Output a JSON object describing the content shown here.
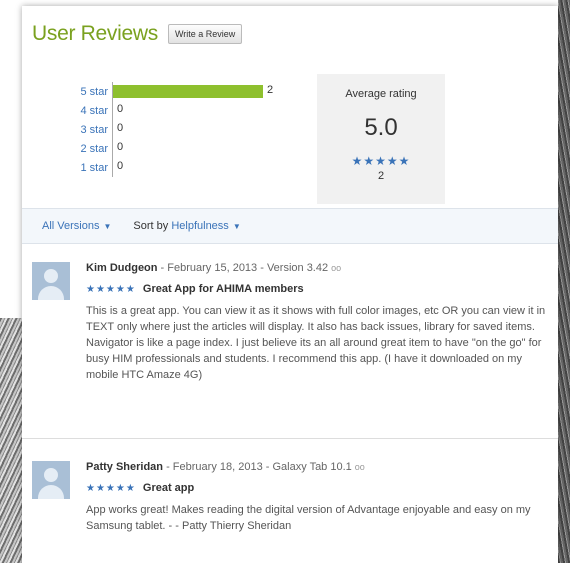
{
  "header": {
    "title": "User Reviews",
    "write_button": "Write a Review"
  },
  "histogram": [
    {
      "label": "5 star",
      "count": "2",
      "fraction": 1.0
    },
    {
      "label": "4 star",
      "count": "0",
      "fraction": 0
    },
    {
      "label": "3 star",
      "count": "0",
      "fraction": 0
    },
    {
      "label": "2 star",
      "count": "0",
      "fraction": 0
    },
    {
      "label": "1 star",
      "count": "0",
      "fraction": 0
    }
  ],
  "average": {
    "label": "Average rating",
    "value": "5.0",
    "stars": "★★★★★",
    "count": "2"
  },
  "filters": {
    "versions": "All Versions",
    "sort_prefix": "Sort by",
    "sort_value": "Helpfulness"
  },
  "reviews": [
    {
      "author": "Kim Dudgeon",
      "meta": " - February 15, 2013 - Version 3.42",
      "dots": "oo",
      "stars": "★★★★★",
      "title": "Great App for AHIMA members",
      "body": "This is a great app. You can view it as it shows with full color images, etc OR you can view it in TEXT only where just the articles will display. It also has back issues, library for saved items. Navigator is like a page index. I just believe its an all around great item to have \"on the go\" for busy HIM professionals and students. I recommend this app. (I have it downloaded on my mobile HTC Amaze 4G)"
    },
    {
      "author": "Patty Sheridan",
      "meta": " - February 18, 2013 - Galaxy Tab 10.1",
      "dots": "oo",
      "stars": "★★★★★",
      "title": "Great app",
      "body": "App works great! Makes reading the digital version of Advantage enjoyable and easy on my Samsung tablet. - - Patty Thierry Sheridan"
    }
  ],
  "colors": {
    "title_green": "#7aa11f",
    "bar_green": "#8ec02e",
    "link_blue": "#3a73b8"
  }
}
